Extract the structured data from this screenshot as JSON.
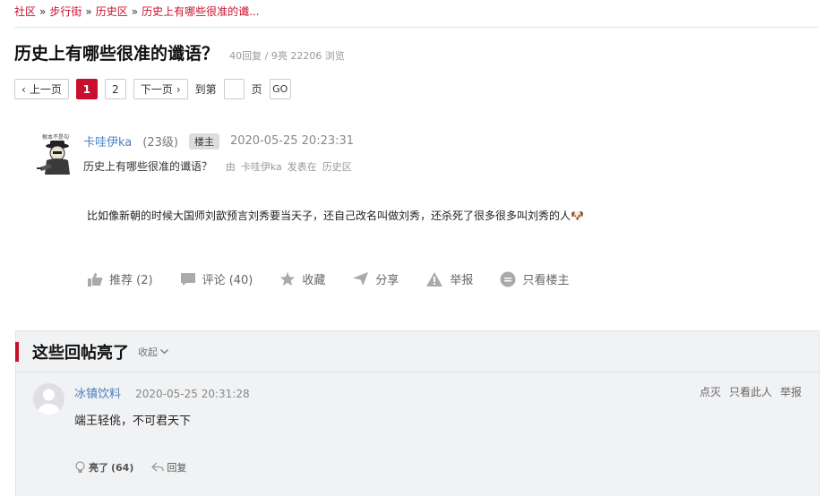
{
  "breadcrumb": {
    "items": [
      "社区",
      "步行街",
      "历史区",
      "历史上有哪些很准的谶..."
    ],
    "separator": "»"
  },
  "thread": {
    "title": "历史上有哪些很准的谶语？",
    "stats": "40回复 / 9亮 22206 浏览"
  },
  "pager": {
    "prev": "上一页",
    "pages": [
      "1",
      "2"
    ],
    "current": "1",
    "next": "下一页",
    "goto_prefix": "到第",
    "goto_suffix": "页",
    "go": "GO"
  },
  "post": {
    "avatar_caption": "根本不是勾",
    "author": "卡哇伊ka",
    "level": "(23级)",
    "badge": "楼主",
    "time": "2020-05-25 20:23:31",
    "subject": "历史上有哪些很准的谶语？",
    "meta_by": "由",
    "meta_author": "卡哇伊ka",
    "meta_posted_in": "发表在",
    "meta_board": "历史区",
    "body": "比如像新朝的时候大国师刘歆预言刘秀要当天子，还自己改名叫做刘秀，还杀死了很多很多叫刘秀的人🐶"
  },
  "actions": {
    "recommend": "推荐 (2)",
    "comment": "评论 (40)",
    "favorite": "收藏",
    "share": "分享",
    "report": "举报",
    "only_op": "只看楼主"
  },
  "hot": {
    "title": "这些回帖亮了",
    "collapse": "收起"
  },
  "reply": {
    "user": "冰镇饮料",
    "time": "2020-05-25 20:31:28",
    "text": "端王轻佻，不可君天下",
    "ops": [
      "点灭",
      "只看此人",
      "举报"
    ],
    "light_label": "亮了",
    "light_count": "(64)",
    "reply_label": "回复"
  },
  "colors": {
    "accent": "#c8102e",
    "link": "#4a7fc1"
  }
}
